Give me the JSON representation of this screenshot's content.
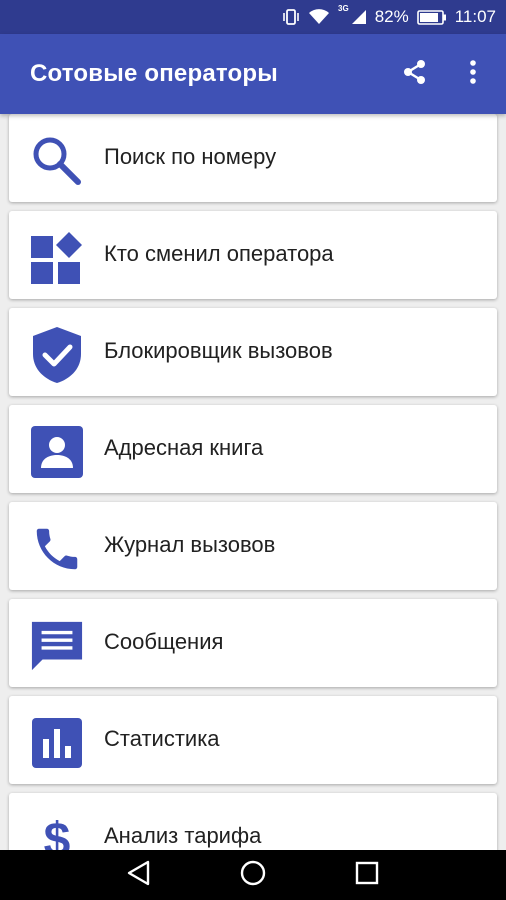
{
  "status_bar": {
    "network": "3G",
    "battery": "82%",
    "time": "11:07",
    "icons": [
      "vibrate-icon",
      "wifi-icon",
      "signal-icon",
      "battery-icon"
    ]
  },
  "app_bar": {
    "title": "Сотовые операторы",
    "actions": [
      "share-icon",
      "more-vert-icon"
    ]
  },
  "menu": [
    {
      "label": "Поиск по номеру",
      "icon": "search-icon"
    },
    {
      "label": "Кто сменил оператора",
      "icon": "widgets-icon"
    },
    {
      "label": "Блокировщик вызовов",
      "icon": "shield-check-icon"
    },
    {
      "label": "Адресная книга",
      "icon": "contact-icon"
    },
    {
      "label": "Журнал вызовов",
      "icon": "phone-icon"
    },
    {
      "label": "Сообщения",
      "icon": "message-icon"
    },
    {
      "label": "Статистика",
      "icon": "bar-chart-icon"
    },
    {
      "label": "Анализ тарифа",
      "icon": "dollar-icon"
    }
  ],
  "nav_bar": [
    "back-icon",
    "home-icon",
    "recents-icon"
  ],
  "colors": {
    "primary": "#3f51b5",
    "primary_dark": "#2f3b8f",
    "icon": "#3f51b5",
    "background": "#eeeeee",
    "card": "#ffffff",
    "text": "#212121"
  }
}
